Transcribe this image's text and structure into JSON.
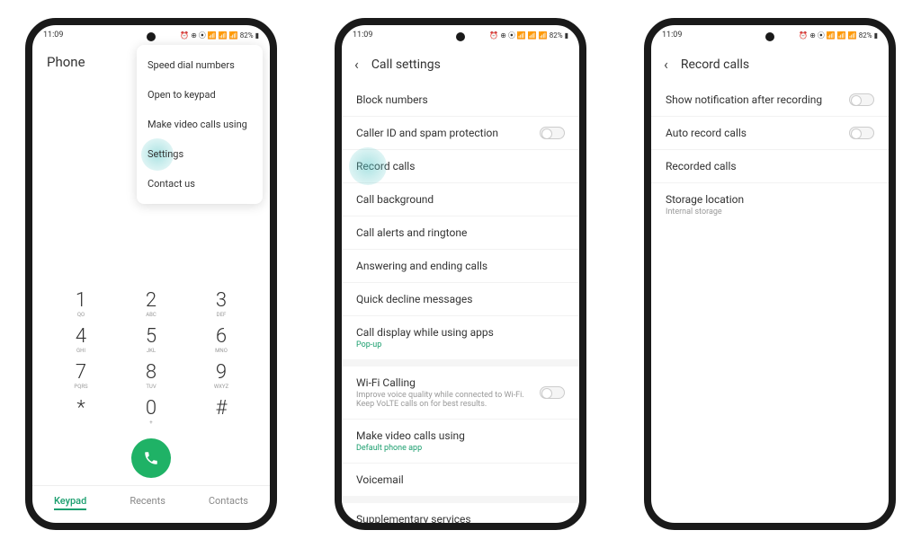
{
  "status": {
    "time": "11:09",
    "icons_text": "⏰ ⊕ ⦿ 📶 📶 📶 82% ▮"
  },
  "phone1": {
    "title": "Phone",
    "menu": {
      "speed_dial": "Speed dial numbers",
      "open_keypad": "Open to keypad",
      "video_calls": "Make video calls using",
      "settings": "Settings",
      "contact_us": "Contact us"
    },
    "keypad": [
      {
        "num": "1",
        "sub": "QO"
      },
      {
        "num": "2",
        "sub": "ABC"
      },
      {
        "num": "3",
        "sub": "DEF"
      },
      {
        "num": "4",
        "sub": "GHI"
      },
      {
        "num": "5",
        "sub": "JKL"
      },
      {
        "num": "6",
        "sub": "MNO"
      },
      {
        "num": "7",
        "sub": "PQRS"
      },
      {
        "num": "8",
        "sub": "TUV"
      },
      {
        "num": "9",
        "sub": "WXYZ"
      },
      {
        "num": "*",
        "sub": ""
      },
      {
        "num": "0",
        "sub": "+"
      },
      {
        "num": "#",
        "sub": ""
      }
    ],
    "tabs": {
      "keypad": "Keypad",
      "recents": "Recents",
      "contacts": "Contacts"
    }
  },
  "phone2": {
    "title": "Call settings",
    "items": {
      "block": "Block numbers",
      "caller_id": "Caller ID and spam protection",
      "record": "Record calls",
      "background": "Call background",
      "alerts": "Call alerts and ringtone",
      "answering": "Answering and ending calls",
      "decline": "Quick decline messages",
      "display": "Call display while using apps",
      "display_sub": "Pop-up",
      "wifi": "Wi-Fi Calling",
      "wifi_sub": "Improve voice quality while connected to Wi-Fi. Keep VoLTE calls on for best results.",
      "video": "Make video calls using",
      "video_sub": "Default phone app",
      "voicemail": "Voicemail",
      "supplementary": "Supplementary services"
    }
  },
  "phone3": {
    "title": "Record calls",
    "items": {
      "notification": "Show notification after recording",
      "auto": "Auto record calls",
      "recorded": "Recorded calls",
      "storage": "Storage location",
      "storage_sub": "Internal storage"
    }
  }
}
